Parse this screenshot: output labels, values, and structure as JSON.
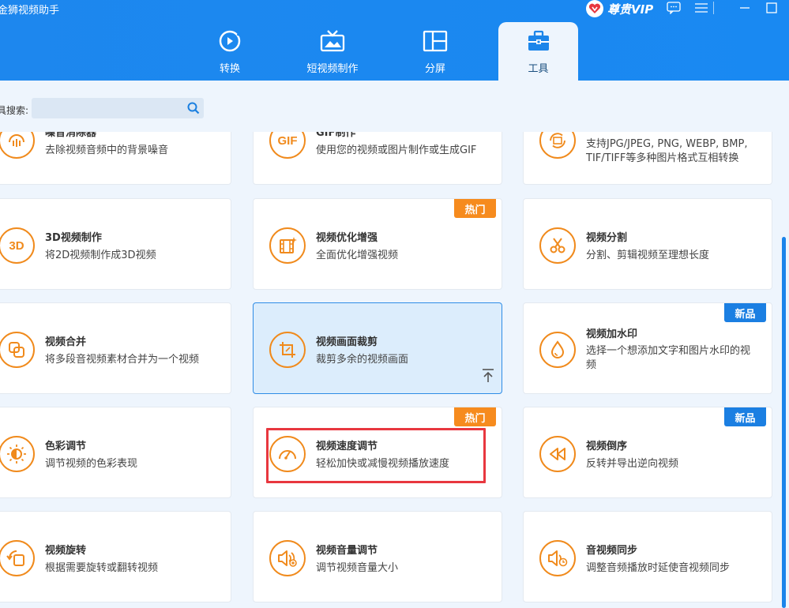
{
  "app": {
    "title": "金狮视频助手",
    "vip_label": "尊贵VIP"
  },
  "nav": [
    {
      "label": "转换",
      "icon": "convert-icon"
    },
    {
      "label": "短视频制作",
      "icon": "short-video-icon"
    },
    {
      "label": "分屏",
      "icon": "split-screen-icon"
    },
    {
      "label": "工具",
      "icon": "toolbox-icon",
      "active": true
    }
  ],
  "search": {
    "label": "具搜索:",
    "placeholder": ""
  },
  "badges": {
    "hot": "热门",
    "new": "新品"
  },
  "tools": [
    {
      "title": "噪音消除器",
      "desc": "去除视频音频中的背景噪音",
      "icon": "noise-icon"
    },
    {
      "title": "GIF制作",
      "desc": "使用您的视频或图片制作或生成GIF",
      "icon_text": "GIF"
    },
    {
      "title": "",
      "desc": "支持JPG/JPEG, PNG, WEBP, BMP, TIF/TIFF等多种图片格式互相转换",
      "icon": "image-convert-icon"
    },
    {
      "title": "3D视频制作",
      "desc": "将2D视频制作成3D视频",
      "icon_text": "3D"
    },
    {
      "title": "视频优化增强",
      "desc": "全面优化增强视频",
      "icon": "enhance-icon"
    },
    {
      "title": "视频分割",
      "desc": "分割、剪辑视频至理想长度",
      "icon": "scissors-icon"
    },
    {
      "title": "视频合并",
      "desc": "将多段音视频素材合并为一个视频",
      "icon": "merge-icon"
    },
    {
      "title": "视频画面裁剪",
      "desc": "裁剪多余的视频画面",
      "icon": "crop-icon"
    },
    {
      "title": "视频加水印",
      "desc": "选择一个想添加文字和图片水印的视频",
      "icon": "watermark-icon"
    },
    {
      "title": "色彩调节",
      "desc": "调节视频的色彩表现",
      "icon": "color-icon"
    },
    {
      "title": "视频速度调节",
      "desc": "轻松加快或减慢视频播放速度",
      "icon": "speed-icon"
    },
    {
      "title": "视频倒序",
      "desc": "反转并导出逆向视频",
      "icon": "reverse-icon"
    },
    {
      "title": "视频旋转",
      "desc": "根据需要旋转或翻转视频",
      "icon": "rotate-icon"
    },
    {
      "title": "视频音量调节",
      "desc": "调节视频音量大小",
      "icon": "volume-icon"
    },
    {
      "title": "音视频同步",
      "desc": "调整音频播放时延使音视频同步",
      "icon": "sync-icon"
    }
  ],
  "colors": {
    "header": "#1989f2",
    "accent": "#f08a1c",
    "highlight": "#e8373f"
  }
}
